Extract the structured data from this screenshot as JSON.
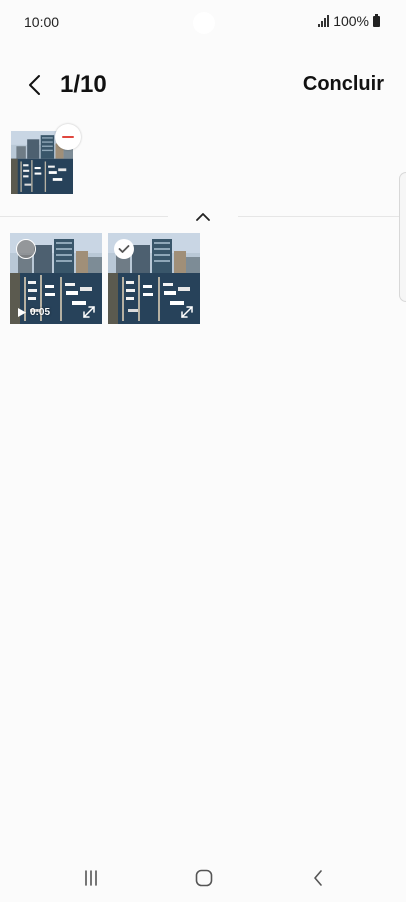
{
  "status": {
    "time": "10:00",
    "battery": "100%"
  },
  "header": {
    "counter": "1/10",
    "done_label": "Concluir"
  },
  "grid": [
    {
      "type": "video",
      "selected": false,
      "duration": "0:05"
    },
    {
      "type": "photo",
      "selected": true
    }
  ],
  "colors": {
    "remove_badge": "#e0473f",
    "background": "#fbfbfb"
  }
}
